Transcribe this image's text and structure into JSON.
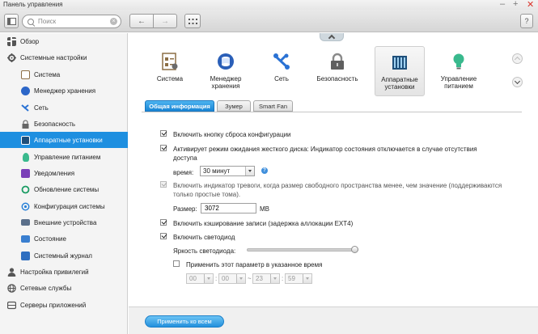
{
  "window": {
    "title": "Панель управления",
    "minimize": "–",
    "maximize": "+",
    "close": "✕"
  },
  "toolbar": {
    "search_placeholder": "Поиск",
    "back_label": "←",
    "forward_label": "→",
    "help_label": "?"
  },
  "sidebar": {
    "items": [
      {
        "label": "Обзор",
        "level": "top"
      },
      {
        "label": "Системные настройки",
        "level": "top"
      },
      {
        "label": "Система",
        "level": "sub"
      },
      {
        "label": "Менеджер хранения",
        "level": "sub"
      },
      {
        "label": "Сеть",
        "level": "sub"
      },
      {
        "label": "Безопасность",
        "level": "sub"
      },
      {
        "label": "Аппаратные установки",
        "level": "sub",
        "selected": true
      },
      {
        "label": "Управление питанием",
        "level": "sub"
      },
      {
        "label": "Уведомления",
        "level": "sub"
      },
      {
        "label": "Обновление системы",
        "level": "sub"
      },
      {
        "label": "Конфигурация системы",
        "level": "sub"
      },
      {
        "label": "Внешние устройства",
        "level": "sub"
      },
      {
        "label": "Состояние",
        "level": "sub"
      },
      {
        "label": "Системный журнал",
        "level": "sub"
      },
      {
        "label": "Настройка привилегий",
        "level": "top"
      },
      {
        "label": "Сетевые службы",
        "level": "top"
      },
      {
        "label": "Серверы приложений",
        "level": "top"
      }
    ]
  },
  "categories": [
    {
      "label_line1": "Система",
      "label_line2": ""
    },
    {
      "label_line1": "Менеджер",
      "label_line2": "хранения"
    },
    {
      "label_line1": "Сеть",
      "label_line2": ""
    },
    {
      "label_line1": "Безопасность",
      "label_line2": ""
    },
    {
      "label_line1": "Аппаратные",
      "label_line2": "установки",
      "selected": true
    },
    {
      "label_line1": "Управление",
      "label_line2": "питанием"
    }
  ],
  "tabs": [
    {
      "label": "Общая информация",
      "active": true
    },
    {
      "label": "Зумер"
    },
    {
      "label": "Smart Fan"
    }
  ],
  "settings": {
    "reset_button": {
      "label": "Включить кнопку сброса конфигурации",
      "checked": true
    },
    "hdd_standby": {
      "label_line1": "Активирует режим ожидания жесткого диска: Индикатор состояния отключается в случае отсутствия",
      "label_line2": "доступа",
      "checked": true,
      "time_label": "время:",
      "time_value": "30 минут"
    },
    "alarm_light": {
      "label_line1": "Включить индикатор тревоги, когда размер свободного пространства менее, чем значение (поддерживаются",
      "label_line2": "только простые тома).",
      "checked": true,
      "disabled": true,
      "size_label": "Размер:",
      "size_value": "3072",
      "size_unit": "MB"
    },
    "write_cache": {
      "label": "Включить кэширование записи (задержка аллокации EXT4)",
      "checked": true
    },
    "led": {
      "label": "Включить светодиод",
      "checked": true
    },
    "brightness": {
      "label": "Яркость светодиода:",
      "level_percent": 100
    },
    "schedule": {
      "label": "Применить этот параметр в указанное время",
      "checked": false,
      "from_hour": "00",
      "from_minute": "00",
      "separator": ":",
      "range_sep": "~",
      "to_hour": "23",
      "to_minute": "59"
    }
  },
  "footer": {
    "apply_all_label": "Применить ко всем"
  },
  "colors": {
    "accent": "#1e8fe0",
    "selected_sidebar": "#1e8fe0"
  }
}
